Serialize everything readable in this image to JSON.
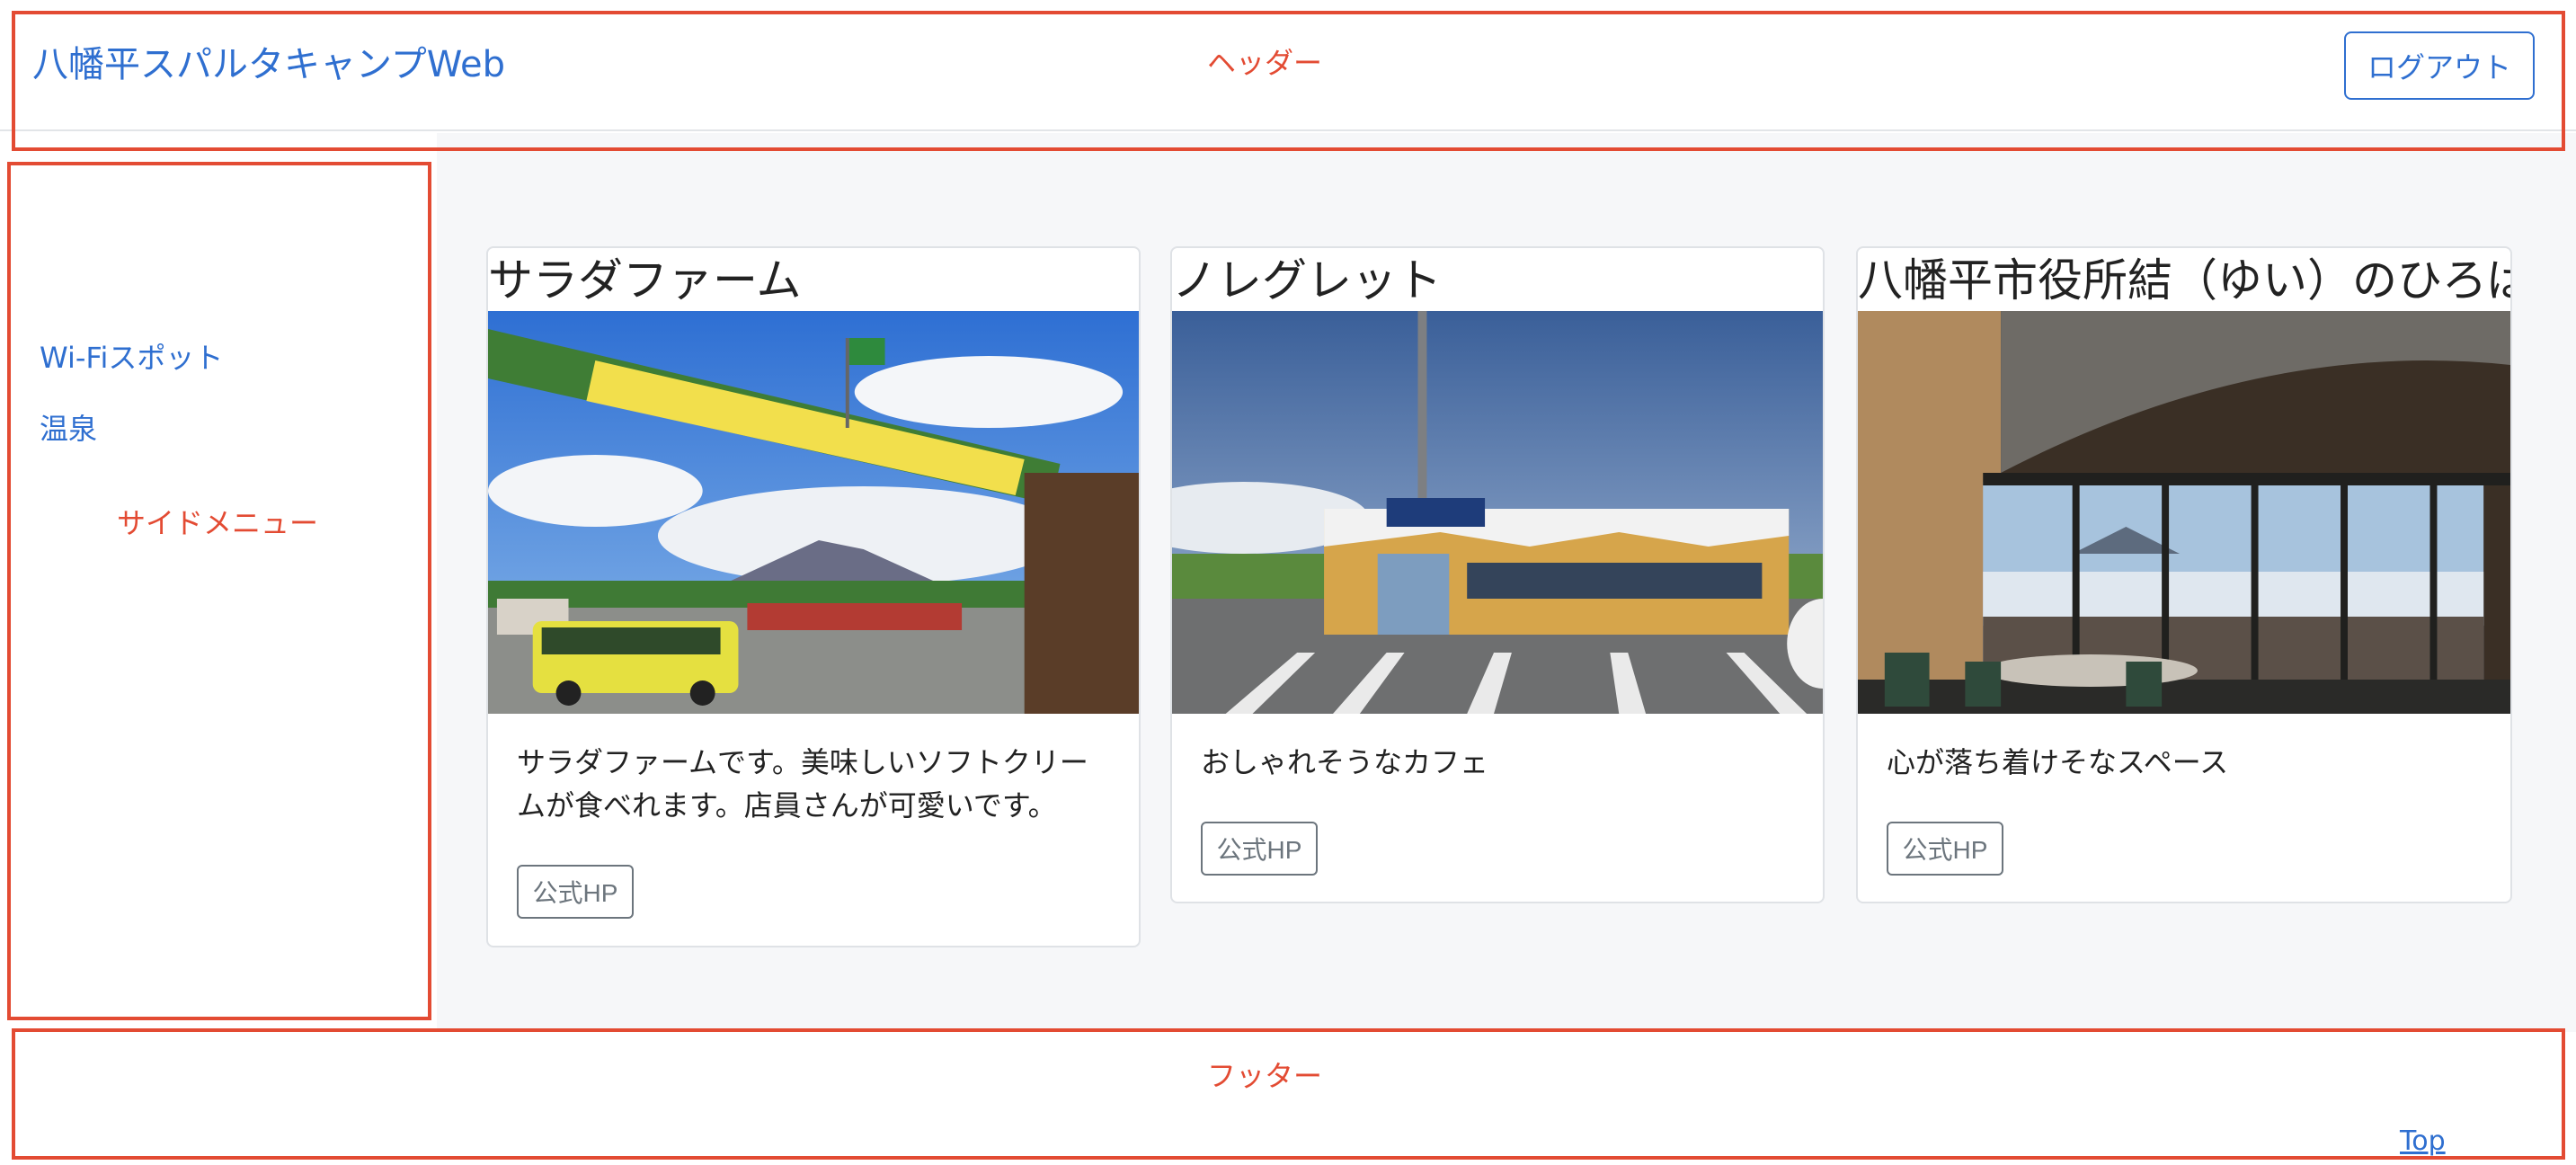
{
  "header": {
    "brand": "八幡平スパルタキャンプWeb",
    "label": "ヘッダー",
    "logout_label": "ログアウト"
  },
  "sidebar": {
    "items": [
      {
        "label": "Wi-Fiスポット"
      },
      {
        "label": "温泉"
      }
    ],
    "label": "サイドメニュー"
  },
  "cards": [
    {
      "title": "サラダファーム",
      "image_alt": "GARDEN PARK entrance sign",
      "text": "サラダファームです。美味しいソフトクリームが食べれます。店員さんが可愛いです。",
      "button_label": "公式HP"
    },
    {
      "title": "ノレグレット",
      "image_alt": "Nollegretto cafe",
      "text": "おしゃれそうなカフェ",
      "button_label": "公式HP"
    },
    {
      "title": "八幡平市役所結（ゆい）のひろば",
      "image_alt": "Interior lobby with glass wall",
      "text": "心が落ち着けそなスペース",
      "button_label": "公式HP"
    }
  ],
  "footer": {
    "label": "フッター",
    "top_link": "Top"
  },
  "colors": {
    "link": "#2f6fd0",
    "annotation": "#e34b33",
    "main_background": "#f6f7f9",
    "secondary_button": "#6c757d"
  }
}
